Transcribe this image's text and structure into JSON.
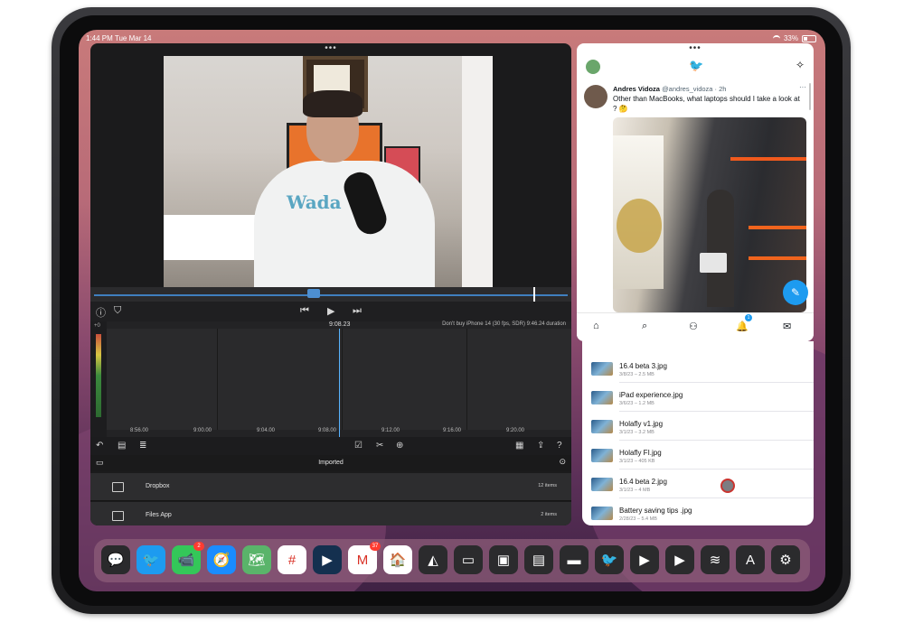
{
  "status_bar": {
    "time": "1:44 PM  Tue Mar 14",
    "battery": "33%"
  },
  "lumafusion": {
    "timecode": "9:08.23",
    "project_info": "Don't buy iPhone 14 (30 fps, SDR)  9:46.24 duration",
    "level_mark": "+0",
    "ticks": [
      "8:56.00",
      "9:00.00",
      "9:04.00",
      "9:08.00",
      "9:12.00",
      "9:16.00",
      "9:20.00"
    ],
    "library_title": "Imported",
    "folders": [
      {
        "name": "Dropbox",
        "count": "12 items"
      },
      {
        "name": "Files App",
        "count": "2 items"
      }
    ]
  },
  "twitter": {
    "author_name": "Andres Vidoza",
    "author_handle": "@andres_vidoza · 2h",
    "tweet_text": "Other than MacBooks, what laptops should I take a look at ? 🤔",
    "more": "···",
    "notification_count": "1"
  },
  "files": [
    {
      "name": "16.4 beta 3.jpg",
      "meta": "3/8/23 – 2.5 MB"
    },
    {
      "name": "iPad experience.jpg",
      "meta": "3/6/23 – 1.2 MB"
    },
    {
      "name": "Holafly v1.jpg",
      "meta": "3/1/23 – 3.2 MB"
    },
    {
      "name": "Holafly FI.jpg",
      "meta": "3/1/23 – 405 KB"
    },
    {
      "name": "16.4 beta 2.jpg",
      "meta": "3/1/23 – 4 MB"
    },
    {
      "name": "Battery saving tips .jpg",
      "meta": "2/28/23 – 5.4 MB"
    }
  ],
  "dock": {
    "apps": [
      {
        "name": "messages-icon",
        "color": "#2a2a2c",
        "glyph": "💬"
      },
      {
        "name": "twitter-icon",
        "color": "#1d9bf0",
        "glyph": "🐦"
      },
      {
        "name": "facetime-icon",
        "color": "#34c759",
        "glyph": "📹",
        "badge": "2"
      },
      {
        "name": "safari-icon",
        "color": "#1a8cff",
        "glyph": "🧭"
      },
      {
        "name": "maps-icon",
        "color": "#5ab46a",
        "glyph": "🗺"
      },
      {
        "name": "slack-icon",
        "color": "#ffffff",
        "glyph": "#"
      },
      {
        "name": "lumafusion-icon",
        "color": "#14304f",
        "glyph": "▶"
      },
      {
        "name": "gmail-icon",
        "color": "#ffffff",
        "glyph": "M",
        "badge": "37"
      },
      {
        "name": "home-icon",
        "color": "#ffffff",
        "glyph": "🏠"
      },
      {
        "name": "affinity-icon",
        "color": "#2b2b2d",
        "glyph": "◭"
      },
      {
        "name": "files-icon",
        "color": "#2b2b2d",
        "glyph": "▭"
      },
      {
        "name": "ipad-icon",
        "color": "#2b2b2d",
        "glyph": "▣"
      },
      {
        "name": "calculator-icon",
        "color": "#2b2b2d",
        "glyph": "▤"
      },
      {
        "name": "folder-icon",
        "color": "#2b2b2d",
        "glyph": "▬"
      },
      {
        "name": "twitter-dark-icon",
        "color": "#2b2b2d",
        "glyph": "🐦"
      },
      {
        "name": "youtube-icon",
        "color": "#2b2b2d",
        "glyph": "▶"
      },
      {
        "name": "youtube-tv-icon",
        "color": "#2b2b2d",
        "glyph": "▶"
      },
      {
        "name": "spotify-icon",
        "color": "#2b2b2d",
        "glyph": "≋"
      },
      {
        "name": "app-store-icon",
        "color": "#2b2b2d",
        "glyph": "A"
      },
      {
        "name": "settings-icon",
        "color": "#2b2b2d",
        "glyph": "⚙"
      }
    ]
  }
}
